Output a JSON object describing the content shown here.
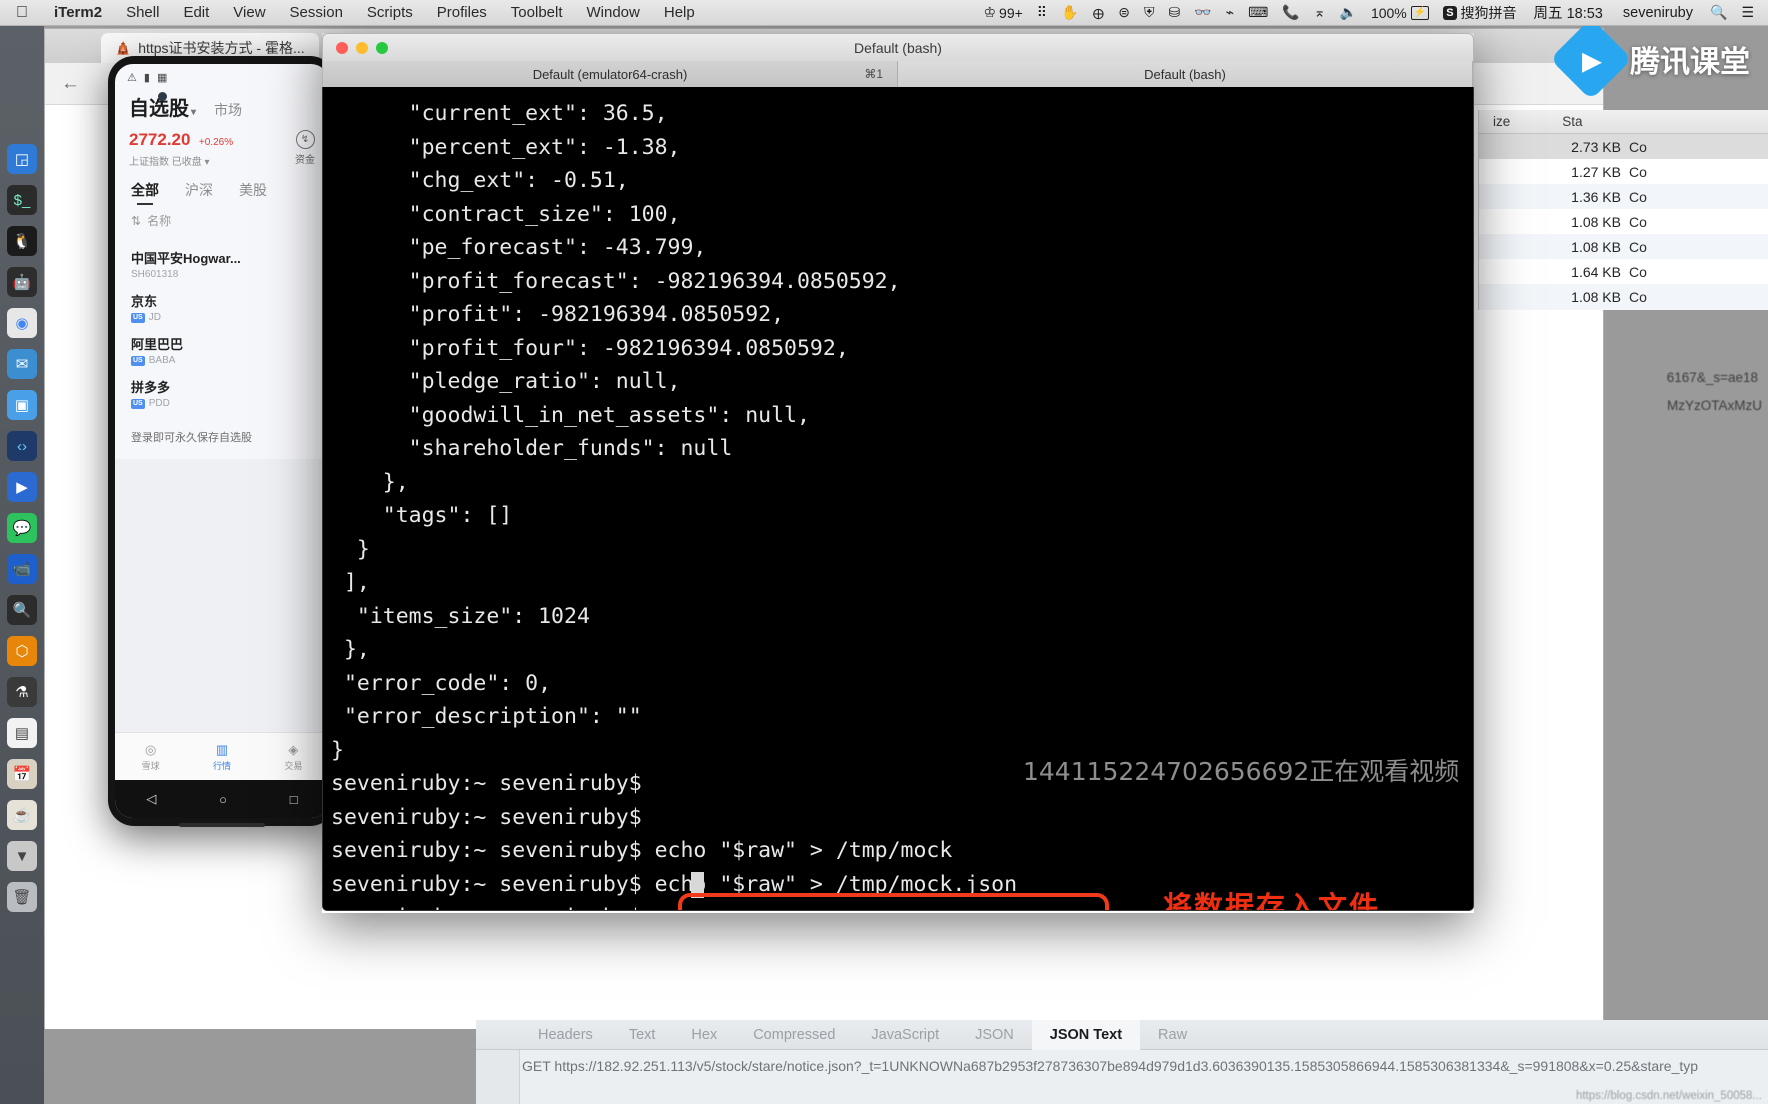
{
  "menubar": {
    "apple": "",
    "items": [
      "iTerm2",
      "Shell",
      "Edit",
      "View",
      "Session",
      "Scripts",
      "Profiles",
      "Toolbelt",
      "Window",
      "Help"
    ],
    "status": {
      "dropbox_count": "99+",
      "battery": "100%",
      "ime": "搜狗拼音",
      "ime_badge": "S",
      "clock": "周五 18:53",
      "user": "seveniruby"
    }
  },
  "browser": {
    "tab_title": "https证书安装方式 - 霍格..."
  },
  "phone": {
    "title": "自选股",
    "market_tab": "市场",
    "index_value": "2772.20",
    "index_percent": "+0.26%",
    "index_name": "上证指数",
    "index_state": "已收盘",
    "fund_label": "资金",
    "tabs": [
      "全部",
      "沪深",
      "美股"
    ],
    "column_header": "名称",
    "stocks": [
      {
        "name": "中国平安Hogwar...",
        "code": "SH601318",
        "badge": ""
      },
      {
        "name": "京东",
        "code": "JD",
        "badge": "US"
      },
      {
        "name": "阿里巴巴",
        "code": "BABA",
        "badge": "US"
      },
      {
        "name": "拼多多",
        "code": "PDD",
        "badge": "US"
      }
    ],
    "login_hint": "登录即可永久保存自选股",
    "bottom_nav": [
      {
        "label": "雪球",
        "icon": "◎"
      },
      {
        "label": "行情",
        "icon": "▥"
      },
      {
        "label": "交易",
        "icon": "◈"
      }
    ],
    "android_nav": [
      "◁",
      "○",
      "□"
    ]
  },
  "iterm": {
    "window_title": "Default (bash)",
    "tabs": [
      {
        "label": "Default (emulator64-crash)",
        "shortcut": "⌘1",
        "active": false
      },
      {
        "label": "Default (bash)",
        "shortcut": "",
        "active": true
      }
    ],
    "terminal_output": "      \"current_ext\": 36.5,\n      \"percent_ext\": -1.38,\n      \"chg_ext\": -0.51,\n      \"contract_size\": 100,\n      \"pe_forecast\": -43.799,\n      \"profit_forecast\": -982196394.0850592,\n      \"profit\": -982196394.0850592,\n      \"profit_four\": -982196394.0850592,\n      \"pledge_ratio\": null,\n      \"goodwill_in_net_assets\": null,\n      \"shareholder_funds\": null\n    },\n    \"tags\": []\n  }\n ],\n  \"items_size\": 1024\n },\n \"error_code\": 0,\n \"error_description\": \"\"\n}\nseveniruby:~ seveniruby$\nseveniruby:~ seveniruby$\nseveniruby:~ seveniruby$ echo \"$raw\" > /tmp/mock\nseveniruby:~ seveniruby$ echo \"$raw\" > /tmp/mock.json\nseveniruby:~ seveniruby$",
    "highlighted_command": "echo \"$raw\" > /tmp/mock.json",
    "annotation_note": "将数据存入文件",
    "watermark": "144115224702656692正在观看视频"
  },
  "ketang": {
    "brand": "腾讯课堂",
    "play_icon": "▶"
  },
  "file_panel": {
    "header_size": "ize",
    "header_status": "Sta",
    "rows": [
      {
        "size": "2.73 KB",
        "status": "Co",
        "selected": true
      },
      {
        "size": "1.27 KB",
        "status": "Co",
        "selected": false
      },
      {
        "size": "1.36 KB",
        "status": "Co",
        "selected": false
      },
      {
        "size": "1.08 KB",
        "status": "Co",
        "selected": false
      },
      {
        "size": "1.08 KB",
        "status": "Co",
        "selected": false
      },
      {
        "size": "1.64 KB",
        "status": "Co",
        "selected": false
      },
      {
        "size": "1.08 KB",
        "status": "Co",
        "selected": false
      },
      {
        "size": "1.08 KB",
        "status": "Co",
        "selected": false
      }
    ],
    "url_frag_1": "6167&_s=ae18",
    "url_frag_2": "MzYzOTAxMzU"
  },
  "charles": {
    "tabs": [
      "Headers",
      "Text",
      "Hex",
      "Compressed",
      "JavaScript",
      "JSON",
      "JSON Text",
      "Raw"
    ],
    "active_tab": "JSON Text",
    "url": "GET https://182.92.251.113/v5/stock/stare/notice.json?_t=1UNKNOWNa687b2953f278736307be894d979d1d3.6036390135.1585305866944.1585306381334&_s=991808&x=0.25&stare_typ",
    "footer": "https://blog.csdn.net/weixin_50058..."
  },
  "colors": {
    "annotation_red": "#ee2f12",
    "index_red": "#e03b33",
    "brand_blue": "#28a7f0",
    "terminal_bg": "#000000",
    "terminal_fg": "#e8e8e8"
  }
}
